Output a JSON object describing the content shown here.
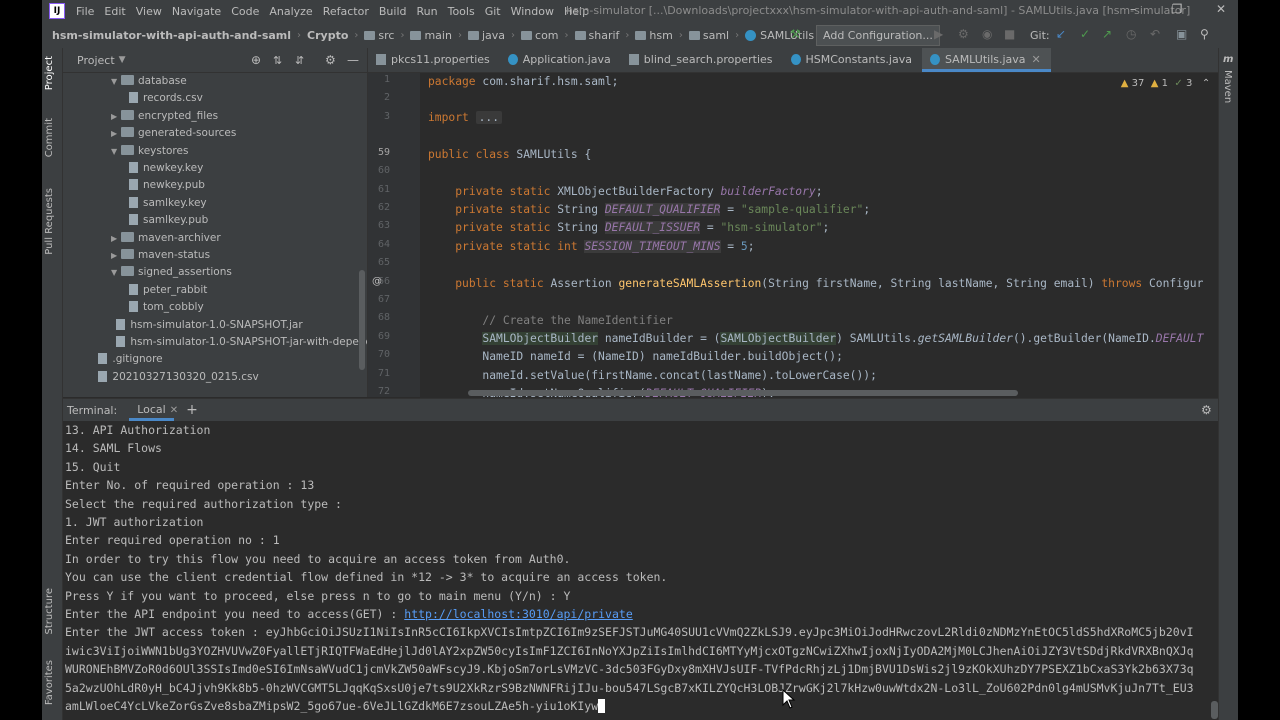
{
  "menubar": {
    "items": [
      "File",
      "Edit",
      "View",
      "Navigate",
      "Code",
      "Analyze",
      "Refactor",
      "Build",
      "Run",
      "Tools",
      "Git",
      "Window",
      "Help"
    ],
    "title": "hsm-simulator [...\\Downloads\\projectxxx\\hsm-simulator-with-api-auth-and-saml] - SAMLUtils.java [hsm-simulator]"
  },
  "navbar": {
    "crumbs": [
      "hsm-simulator-with-api-auth-and-saml",
      "Crypto",
      "src",
      "main",
      "java",
      "com",
      "sharif",
      "hsm",
      "saml",
      "SAMLUtils"
    ],
    "add_config": "Add Configuration...",
    "git_label": "Git:"
  },
  "left_tabs": [
    "Project",
    "Commit",
    "Pull Requests",
    "Structure",
    "Favorites"
  ],
  "project": {
    "title": "Project",
    "tree": [
      {
        "label": "database",
        "type": "folder",
        "open": true,
        "depth": 1
      },
      {
        "label": "records.csv",
        "type": "file",
        "depth": 2
      },
      {
        "label": "encrypted_files",
        "type": "folder",
        "open": false,
        "depth": 1
      },
      {
        "label": "generated-sources",
        "type": "folder",
        "open": false,
        "depth": 1
      },
      {
        "label": "keystores",
        "type": "folder",
        "open": true,
        "depth": 1
      },
      {
        "label": "newkey.key",
        "type": "file",
        "depth": 2
      },
      {
        "label": "newkey.pub",
        "type": "file",
        "depth": 2
      },
      {
        "label": "samlkey.key",
        "type": "file",
        "depth": 2
      },
      {
        "label": "samlkey.pub",
        "type": "file",
        "depth": 2
      },
      {
        "label": "maven-archiver",
        "type": "folder",
        "open": false,
        "depth": 1
      },
      {
        "label": "maven-status",
        "type": "folder",
        "open": false,
        "depth": 1
      },
      {
        "label": "signed_assertions",
        "type": "folder",
        "open": true,
        "depth": 1
      },
      {
        "label": "peter_rabbit",
        "type": "file",
        "depth": 2
      },
      {
        "label": "tom_cobbly",
        "type": "file",
        "depth": 2
      },
      {
        "label": "hsm-simulator-1.0-SNAPSHOT.jar",
        "type": "file",
        "depth": 1.3
      },
      {
        "label": "hsm-simulator-1.0-SNAPSHOT-jar-with-depend",
        "type": "file",
        "depth": 1.3
      },
      {
        "label": ".gitignore",
        "type": "file",
        "depth": 0.3
      },
      {
        "label": "20210327130320_0215.csv",
        "type": "file",
        "depth": 0.3
      }
    ]
  },
  "editor": {
    "tabs": [
      "pkcs11.properties",
      "Application.java",
      "blind_search.properties",
      "HSMConstants.java",
      "SAMLUtils.java"
    ],
    "active_tab": 4,
    "inspections": {
      "warnings": "37",
      "weak": "1",
      "typos": "3"
    },
    "line_numbers": [
      "1",
      "2",
      "3",
      "59",
      "60",
      "61",
      "62",
      "63",
      "64",
      "65",
      "66",
      "67",
      "68",
      "69",
      "70",
      "71",
      "72"
    ]
  },
  "right_tabs": [
    "Maven"
  ],
  "terminal": {
    "label": "Terminal:",
    "tab": "Local",
    "lines": [
      "13. API Authorization",
      "14. SAML Flows",
      "15. Quit",
      "Enter No. of required operation : 13",
      "Select the required authorization type :",
      "1. JWT authorization",
      "Enter required operation no : 1",
      "In order to try this flow you need to acquire an access token from Auth0.",
      "You can use the client credential flow defined in *12 -> 3* to acquire an access token.",
      "Press Y if you want to proceed, else press n to go to main menu (Y/n) : Y",
      "Enter the API endpoint you need to access(GET) : ",
      "Enter the JWT access token : eyJhbGciOiJSUzI1NiIsInR5cCI6IkpXVCIsImtpZCI6Im9zSEFJSTJuMG40SUU1cVVmQ2ZkLSJ9.eyJpc3MiOiJodHRwczovL2Rldi0zNDMzYnEtOC5ldS5hdXRoMC5jb20vI",
      "iwic3ViIjoiWWN1bUg3YOZHVUVwZ0FyallETjRIQTFWaEdHejlJd0lAY2xpZW50cyIsImF1ZCI6InNoYXJpZiIsImlhdCI6MTYyMjcxOTgzNCwiZXhwIjoxNjIyODA2MjM0LCJhenAiOiJZY3VtSDdjRkdVRXBnQXJq",
      "WURONEhBMVZoR0d6OUl3SSIsImd0eSI6ImNsaWVudC1jcmVkZW50aWFscyJ9.KbjoSm7orLsVMzVC-3dc503FGyDxy8mXHVJsUIF-TVfPdcRhjzLj1DmjBVU1DsWis2jl9zKOkXUhzDY7PSEXZ1bCxaS3Yk2b63X73q",
      "5a2wzUOhLdR0yH_bC4Jjvh9Kk8b5-0hzWVCGMT5LJqqKqSxsU0je7ts9U2XkRzrS9BzNWNFRijIJu-bou547LSgcB7xKILZYQcH3LOBJZrwGKj2l7kHzw0uwWtdx2N-Lo3lL_ZoU602Pdn0lg4mUSMvKjuJn7Tt_EU3",
      "amLWloeC4YcLVkeZorGsZve8sbaZMipsW2_5go67ue-6VeJLlGZdkM6E7zsouLZAe5h-yiu1oKIyw"
    ],
    "link": "http://localhost:3010/api/private"
  }
}
